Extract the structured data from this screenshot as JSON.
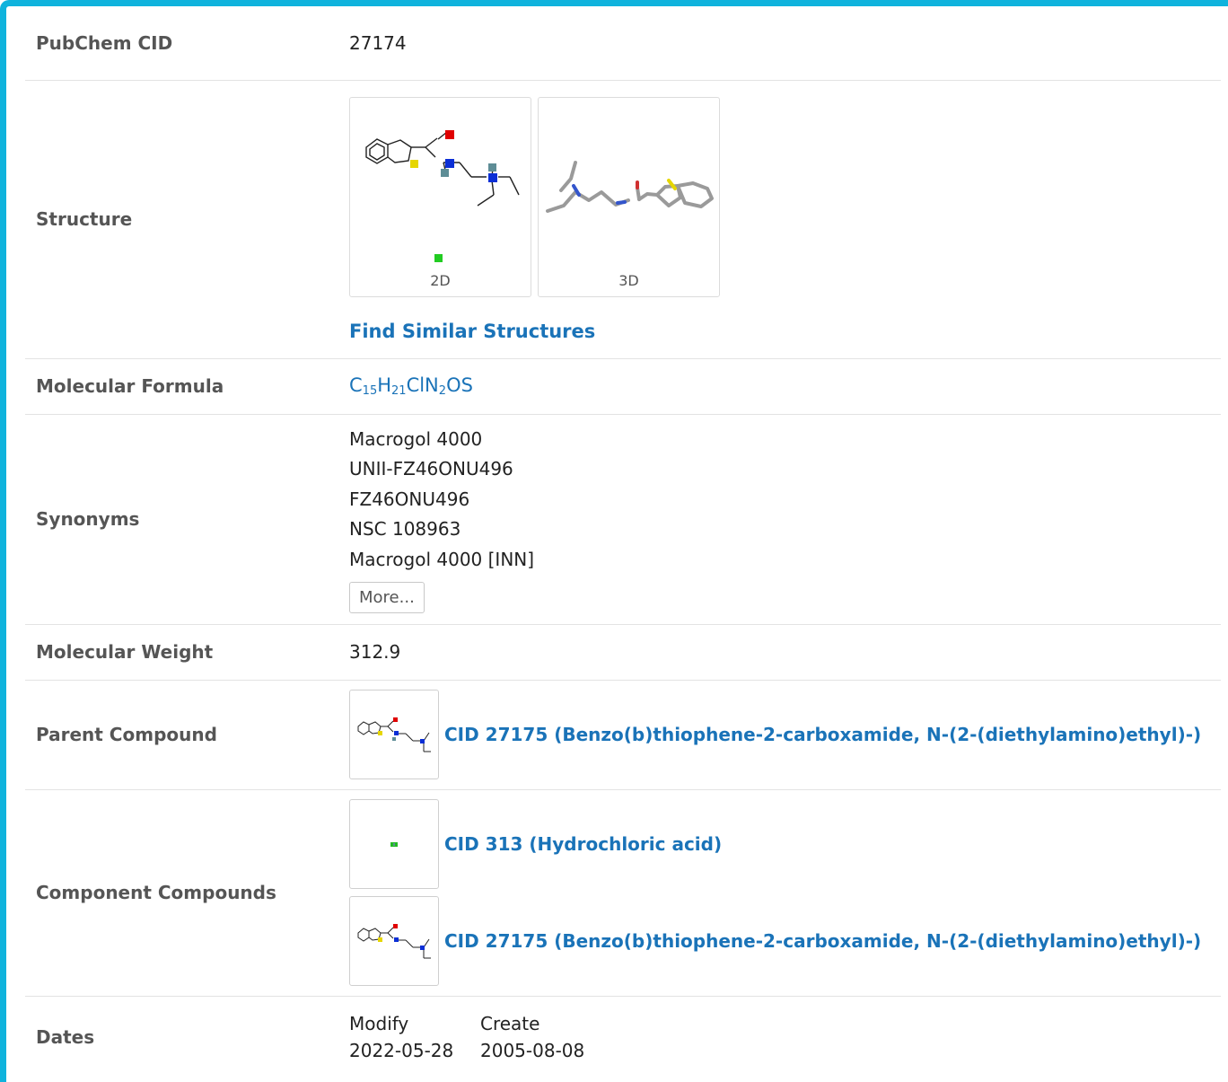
{
  "rows": {
    "cid": {
      "label": "PubChem CID",
      "value": "27174"
    },
    "structure": {
      "label": "Structure",
      "tab_2d": "2D",
      "tab_3d": "3D",
      "find_similar": "Find Similar Structures"
    },
    "formula": {
      "label": "Molecular Formula",
      "parts": [
        "C",
        "15",
        "H",
        "21",
        "ClN",
        "2",
        "OS"
      ]
    },
    "synonyms": {
      "label": "Synonyms",
      "items": [
        "Macrogol 4000",
        "UNII-FZ46ONU496",
        "FZ46ONU496",
        "NSC 108963",
        "Macrogol 4000 [INN]"
      ],
      "more": "More..."
    },
    "weight": {
      "label": "Molecular Weight",
      "value": "312.9"
    },
    "parent": {
      "label": "Parent Compound",
      "link": "CID 27175 (Benzo(b)thiophene-2-carboxamide, N-(2-(diethylamino)ethyl)-)"
    },
    "components": {
      "label": "Component Compounds",
      "items": [
        "CID 313 (Hydrochloric acid)",
        "CID 27175 (Benzo(b)thiophene-2-carboxamide, N-(2-(diethylamino)ethyl)-)"
      ]
    },
    "dates": {
      "label": "Dates",
      "headers": [
        "Modify",
        "Create"
      ],
      "values": [
        "2022-05-28",
        "2005-08-08"
      ]
    }
  },
  "colors": {
    "accent_border": "#0fb3dd",
    "link": "#1a73b8",
    "label": "#555555"
  }
}
